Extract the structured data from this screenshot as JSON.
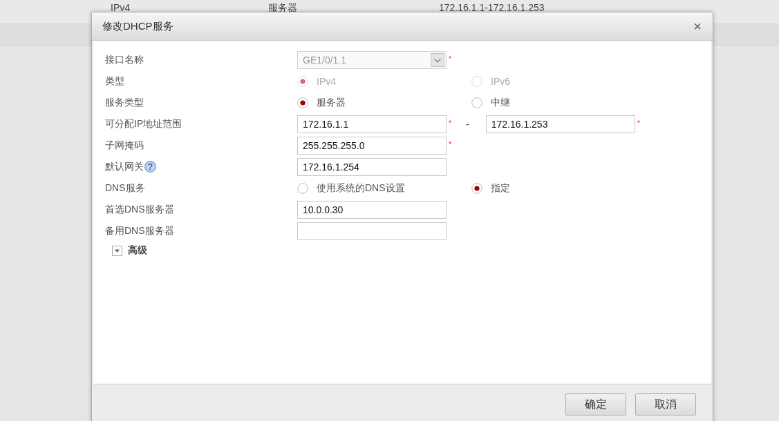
{
  "background_row": {
    "column_1": "IPv4",
    "column_2": "服务器",
    "column_3": "172.16.1.1-172.16.1.253"
  },
  "dialog": {
    "title": "修改DHCP服务",
    "close": "×",
    "fields": [
      {
        "kind": "select",
        "label": "接口名称",
        "value": "GE1/0/1.1",
        "disabled": true,
        "required": "*"
      },
      {
        "kind": "radio",
        "label": "类型",
        "disabled": true,
        "options": [
          {
            "label": "IPv4",
            "selected": true
          },
          {
            "label": "IPv6",
            "selected": false
          }
        ]
      },
      {
        "kind": "radio",
        "label": "服务类型",
        "disabled": false,
        "options": [
          {
            "label": "服务器",
            "selected": true
          },
          {
            "label": "中继",
            "selected": false
          }
        ]
      },
      {
        "kind": "range",
        "label": "可分配IP地址范围",
        "separator": "-",
        "from": {
          "value": "172.16.1.1",
          "required": "*"
        },
        "to": {
          "value": "172.16.1.253",
          "required": "*"
        }
      },
      {
        "kind": "input",
        "label": "子网掩码",
        "value": "255.255.255.0",
        "required": "*"
      },
      {
        "kind": "input",
        "label": "默认网关",
        "help": "?",
        "value": "172.16.1.254"
      },
      {
        "kind": "radio",
        "label": "DNS服务",
        "disabled": false,
        "options": [
          {
            "label": "使用系统的DNS设置",
            "selected": false
          },
          {
            "label": "指定",
            "selected": true
          }
        ]
      },
      {
        "kind": "input",
        "label": "首选DNS服务器",
        "value": "10.0.0.30"
      },
      {
        "kind": "input",
        "label": "备用DNS服务器"
      }
    ],
    "advanced": {
      "label": "高级",
      "expanded": false
    },
    "buttons": [
      "确定",
      "取消"
    ]
  }
}
